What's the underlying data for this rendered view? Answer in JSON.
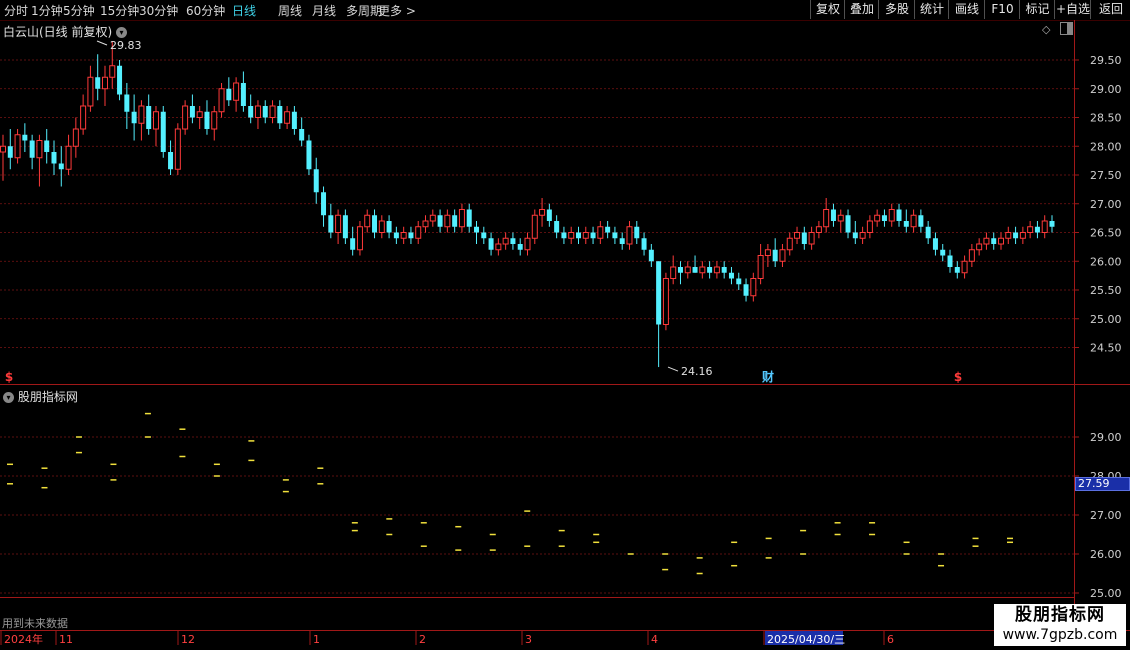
{
  "toolbar": {
    "periods": [
      "分时",
      "1分钟",
      "5分钟",
      "15分钟",
      "30分钟",
      "60分钟",
      "日线",
      "周线",
      "月线",
      "多周期",
      "更多 >"
    ],
    "active_period": "日线",
    "buttons": [
      "复权",
      "叠加",
      "多股",
      "统计",
      "画线",
      "F10",
      "标记",
      "+自选",
      "返回"
    ]
  },
  "main_pane": {
    "title": "白云山(日线 前复权)",
    "max_label": "29.83",
    "min_label": "24.16",
    "markers": [
      "$",
      "财",
      "$"
    ],
    "y_ticks": [
      "29.50",
      "29.00",
      "28.50",
      "28.00",
      "27.50",
      "27.00",
      "26.50",
      "26.00",
      "25.50",
      "25.00",
      "24.50"
    ]
  },
  "sub_pane": {
    "title": "股朋指标网",
    "current_value": "27.59",
    "y_ticks": [
      "29.00",
      "28.00",
      "27.00",
      "26.00",
      "25.00"
    ],
    "footer_note": "用到未来数据"
  },
  "time_axis": {
    "labels": [
      "2024年",
      "11",
      "12",
      "1",
      "2",
      "3",
      "4",
      "2025/04/30/三",
      "6"
    ]
  },
  "watermark": {
    "line1": "股朋指标网",
    "line2": "www.7gpzb.com"
  },
  "colors": {
    "up": "#ff3a3a",
    "down": "#54f0ff",
    "signal": "#f0e03c",
    "grid": "#7a1414",
    "active": "#3fd2e8",
    "highlight_bg": "#1a2fa8"
  },
  "chart_data": {
    "type": "candlestick",
    "ylim": [
      24.0,
      30.0
    ],
    "candles": [
      [
        27.9,
        28.2,
        27.4,
        28.0
      ],
      [
        28.0,
        28.3,
        27.6,
        27.8
      ],
      [
        27.8,
        28.3,
        27.7,
        28.2
      ],
      [
        28.2,
        28.4,
        27.9,
        28.1
      ],
      [
        28.1,
        28.2,
        27.6,
        27.8
      ],
      [
        27.8,
        28.2,
        27.3,
        28.1
      ],
      [
        28.1,
        28.3,
        27.7,
        27.9
      ],
      [
        27.9,
        28.1,
        27.5,
        27.7
      ],
      [
        27.7,
        28.0,
        27.3,
        27.6
      ],
      [
        27.6,
        28.2,
        27.5,
        28.0
      ],
      [
        28.0,
        28.5,
        27.8,
        28.3
      ],
      [
        28.3,
        28.9,
        28.2,
        28.7
      ],
      [
        28.7,
        29.4,
        28.6,
        29.2
      ],
      [
        29.2,
        29.6,
        28.8,
        29.0
      ],
      [
        29.0,
        29.4,
        28.7,
        29.2
      ],
      [
        29.2,
        29.83,
        29.0,
        29.4
      ],
      [
        29.4,
        29.5,
        28.8,
        28.9
      ],
      [
        28.9,
        29.1,
        28.3,
        28.6
      ],
      [
        28.6,
        28.9,
        28.1,
        28.4
      ],
      [
        28.4,
        28.8,
        28.1,
        28.7
      ],
      [
        28.7,
        28.9,
        28.2,
        28.3
      ],
      [
        28.3,
        28.7,
        28.0,
        28.6
      ],
      [
        28.6,
        28.7,
        27.8,
        27.9
      ],
      [
        27.9,
        28.1,
        27.5,
        27.6
      ],
      [
        27.6,
        28.4,
        27.5,
        28.3
      ],
      [
        28.3,
        28.8,
        28.2,
        28.7
      ],
      [
        28.7,
        28.9,
        28.4,
        28.5
      ],
      [
        28.5,
        28.7,
        28.3,
        28.6
      ],
      [
        28.6,
        28.8,
        28.2,
        28.3
      ],
      [
        28.3,
        28.7,
        28.1,
        28.6
      ],
      [
        28.6,
        29.1,
        28.5,
        29.0
      ],
      [
        29.0,
        29.2,
        28.7,
        28.8
      ],
      [
        28.8,
        29.2,
        28.6,
        29.1
      ],
      [
        29.1,
        29.3,
        28.6,
        28.7
      ],
      [
        28.7,
        28.9,
        28.4,
        28.5
      ],
      [
        28.5,
        28.8,
        28.3,
        28.7
      ],
      [
        28.7,
        28.8,
        28.4,
        28.5
      ],
      [
        28.5,
        28.8,
        28.4,
        28.7
      ],
      [
        28.7,
        28.8,
        28.3,
        28.4
      ],
      [
        28.4,
        28.7,
        28.3,
        28.6
      ],
      [
        28.6,
        28.7,
        28.2,
        28.3
      ],
      [
        28.3,
        28.5,
        28.0,
        28.1
      ],
      [
        28.1,
        28.2,
        27.5,
        27.6
      ],
      [
        27.6,
        27.8,
        27.0,
        27.2
      ],
      [
        27.2,
        27.3,
        26.6,
        26.8
      ],
      [
        26.8,
        27.0,
        26.4,
        26.5
      ],
      [
        26.5,
        26.9,
        26.3,
        26.8
      ],
      [
        26.8,
        26.9,
        26.3,
        26.4
      ],
      [
        26.4,
        26.6,
        26.1,
        26.2
      ],
      [
        26.2,
        26.7,
        26.1,
        26.6
      ],
      [
        26.6,
        26.9,
        26.5,
        26.8
      ],
      [
        26.8,
        26.9,
        26.4,
        26.5
      ],
      [
        26.5,
        26.8,
        26.4,
        26.7
      ],
      [
        26.7,
        26.8,
        26.4,
        26.5
      ],
      [
        26.5,
        26.6,
        26.3,
        26.4
      ],
      [
        26.4,
        26.6,
        26.3,
        26.5
      ],
      [
        26.5,
        26.6,
        26.3,
        26.4
      ],
      [
        26.4,
        26.7,
        26.3,
        26.6
      ],
      [
        26.6,
        26.8,
        26.5,
        26.7
      ],
      [
        26.7,
        26.9,
        26.6,
        26.8
      ],
      [
        26.8,
        26.9,
        26.5,
        26.6
      ],
      [
        26.6,
        26.9,
        26.5,
        26.8
      ],
      [
        26.8,
        26.9,
        26.5,
        26.6
      ],
      [
        26.6,
        27.0,
        26.5,
        26.9
      ],
      [
        26.9,
        27.0,
        26.5,
        26.6
      ],
      [
        26.6,
        26.7,
        26.3,
        26.5
      ],
      [
        26.5,
        26.6,
        26.3,
        26.4
      ],
      [
        26.4,
        26.5,
        26.1,
        26.2
      ],
      [
        26.2,
        26.4,
        26.1,
        26.3
      ],
      [
        26.3,
        26.5,
        26.2,
        26.4
      ],
      [
        26.4,
        26.5,
        26.2,
        26.3
      ],
      [
        26.3,
        26.4,
        26.1,
        26.2
      ],
      [
        26.2,
        26.5,
        26.1,
        26.4
      ],
      [
        26.4,
        26.9,
        26.3,
        26.8
      ],
      [
        26.8,
        27.1,
        26.6,
        26.9
      ],
      [
        26.9,
        27.0,
        26.6,
        26.7
      ],
      [
        26.7,
        26.8,
        26.4,
        26.5
      ],
      [
        26.5,
        26.6,
        26.3,
        26.4
      ],
      [
        26.4,
        26.6,
        26.3,
        26.5
      ],
      [
        26.5,
        26.6,
        26.3,
        26.4
      ],
      [
        26.4,
        26.6,
        26.3,
        26.5
      ],
      [
        26.5,
        26.6,
        26.3,
        26.4
      ],
      [
        26.4,
        26.7,
        26.3,
        26.6
      ],
      [
        26.6,
        26.7,
        26.4,
        26.5
      ],
      [
        26.5,
        26.6,
        26.3,
        26.4
      ],
      [
        26.4,
        26.5,
        26.2,
        26.3
      ],
      [
        26.3,
        26.7,
        26.2,
        26.6
      ],
      [
        26.6,
        26.7,
        26.3,
        26.4
      ],
      [
        26.4,
        26.5,
        26.1,
        26.2
      ],
      [
        26.2,
        26.3,
        25.9,
        26.0
      ],
      [
        26.0,
        26.0,
        24.16,
        24.9
      ],
      [
        24.9,
        25.8,
        24.8,
        25.7
      ],
      [
        25.7,
        26.1,
        25.6,
        25.9
      ],
      [
        25.9,
        26.0,
        25.6,
        25.8
      ],
      [
        25.8,
        26.0,
        25.7,
        25.9
      ],
      [
        25.9,
        26.1,
        25.8,
        25.8
      ],
      [
        25.8,
        26.0,
        25.7,
        25.9
      ],
      [
        25.9,
        26.0,
        25.7,
        25.8
      ],
      [
        25.8,
        26.0,
        25.7,
        25.9
      ],
      [
        25.9,
        26.0,
        25.7,
        25.8
      ],
      [
        25.8,
        25.9,
        25.6,
        25.7
      ],
      [
        25.7,
        25.8,
        25.5,
        25.6
      ],
      [
        25.6,
        25.7,
        25.3,
        25.4
      ],
      [
        25.4,
        25.8,
        25.3,
        25.7
      ],
      [
        25.7,
        26.3,
        25.6,
        26.1
      ],
      [
        26.1,
        26.3,
        25.9,
        26.2
      ],
      [
        26.2,
        26.4,
        25.9,
        26.0
      ],
      [
        26.0,
        26.3,
        25.9,
        26.2
      ],
      [
        26.2,
        26.5,
        26.1,
        26.4
      ],
      [
        26.4,
        26.6,
        26.3,
        26.5
      ],
      [
        26.5,
        26.6,
        26.2,
        26.3
      ],
      [
        26.3,
        26.6,
        26.2,
        26.5
      ],
      [
        26.5,
        26.7,
        26.4,
        26.6
      ],
      [
        26.6,
        27.1,
        26.5,
        26.9
      ],
      [
        26.9,
        27.0,
        26.6,
        26.7
      ],
      [
        26.7,
        26.9,
        26.5,
        26.8
      ],
      [
        26.8,
        26.9,
        26.4,
        26.5
      ],
      [
        26.5,
        26.7,
        26.3,
        26.4
      ],
      [
        26.4,
        26.6,
        26.3,
        26.5
      ],
      [
        26.5,
        26.8,
        26.4,
        26.7
      ],
      [
        26.7,
        26.9,
        26.6,
        26.8
      ],
      [
        26.8,
        26.9,
        26.6,
        26.7
      ],
      [
        26.7,
        27.0,
        26.6,
        26.9
      ],
      [
        26.9,
        27.0,
        26.6,
        26.7
      ],
      [
        26.7,
        26.9,
        26.5,
        26.6
      ],
      [
        26.6,
        26.9,
        26.5,
        26.8
      ],
      [
        26.8,
        26.9,
        26.5,
        26.6
      ],
      [
        26.6,
        26.7,
        26.3,
        26.4
      ],
      [
        26.4,
        26.5,
        26.1,
        26.2
      ],
      [
        26.2,
        26.3,
        26.0,
        26.1
      ],
      [
        26.1,
        26.2,
        25.8,
        25.9
      ],
      [
        25.9,
        26.0,
        25.7,
        25.8
      ],
      [
        25.8,
        26.1,
        25.7,
        26.0
      ],
      [
        26.0,
        26.3,
        25.9,
        26.2
      ],
      [
        26.2,
        26.4,
        26.1,
        26.3
      ],
      [
        26.3,
        26.5,
        26.2,
        26.4
      ],
      [
        26.4,
        26.5,
        26.2,
        26.3
      ],
      [
        26.3,
        26.5,
        26.2,
        26.4
      ],
      [
        26.4,
        26.6,
        26.3,
        26.5
      ],
      [
        26.5,
        26.6,
        26.3,
        26.4
      ],
      [
        26.4,
        26.6,
        26.3,
        26.5
      ],
      [
        26.5,
        26.7,
        26.4,
        26.6
      ],
      [
        26.6,
        26.7,
        26.4,
        26.5
      ],
      [
        26.5,
        26.8,
        26.4,
        26.7
      ],
      [
        26.7,
        26.8,
        26.5,
        26.6
      ]
    ],
    "signals": [
      [
        28.3,
        27.8
      ],
      [
        28.2,
        27.7
      ],
      [
        29.0,
        28.6
      ],
      [
        28.3,
        27.9
      ],
      [
        29.6,
        29.0
      ],
      [
        29.2,
        28.5
      ],
      [
        28.3,
        28.0
      ],
      [
        28.9,
        28.4
      ],
      [
        27.9,
        27.6
      ],
      [
        28.2,
        27.8
      ],
      [
        26.8,
        26.6
      ],
      [
        26.9,
        26.5
      ],
      [
        26.8,
        26.2
      ],
      [
        26.7,
        26.1
      ],
      [
        26.5,
        26.1
      ],
      [
        27.1,
        26.2
      ],
      [
        26.6,
        26.2
      ],
      [
        26.5,
        26.3
      ],
      [
        26.0,
        24.0
      ],
      [
        26.0,
        25.6
      ],
      [
        25.9,
        25.5
      ],
      [
        26.3,
        25.7
      ],
      [
        26.4,
        25.9
      ],
      [
        26.6,
        26.0
      ],
      [
        26.8,
        26.5
      ],
      [
        26.8,
        26.5
      ],
      [
        26.3,
        26.0
      ],
      [
        26.0,
        25.7
      ],
      [
        26.4,
        26.2
      ],
      [
        26.4,
        26.3
      ]
    ]
  }
}
